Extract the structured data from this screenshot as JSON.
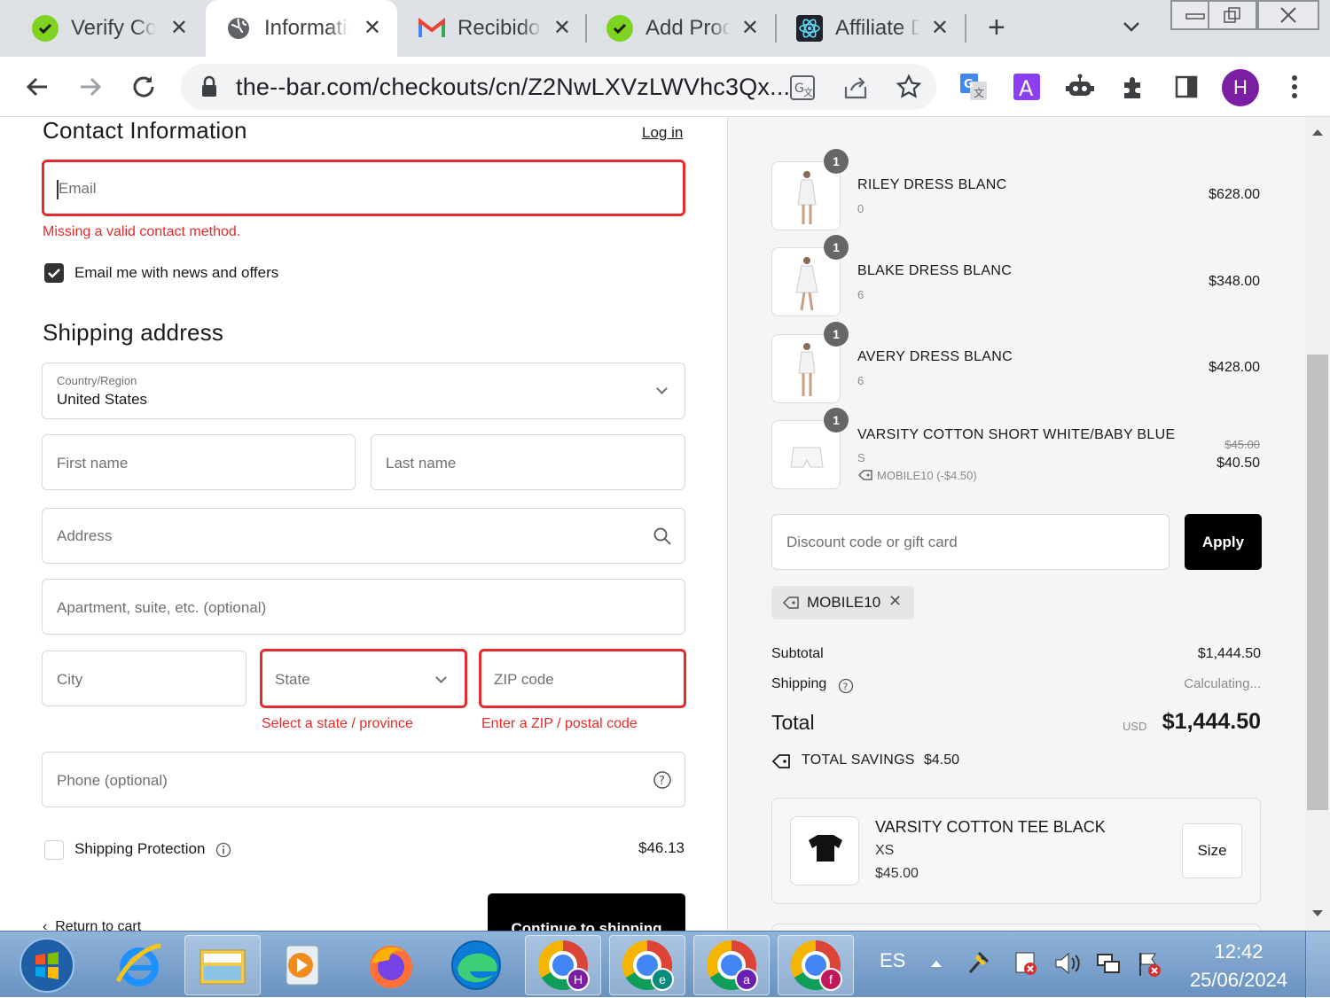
{
  "browser": {
    "tabs": [
      {
        "title": "Verify Code",
        "icon": "shopify-check-icon",
        "active": false
      },
      {
        "title": "Information",
        "icon": "globe-icon",
        "active": true
      },
      {
        "title": "Recibidos",
        "icon": "gmail-icon",
        "active": false
      },
      {
        "title": "Add Product",
        "icon": "shopify-check-icon",
        "active": false
      },
      {
        "title": "Affiliate Dashboard",
        "icon": "react-icon",
        "active": false
      }
    ],
    "url": "the--bar.com/checkouts/cn/Z2NwLXVzLWVhc3Qx...",
    "profile_initial": "H"
  },
  "contact": {
    "heading": "Contact Information",
    "login_link": "Log in",
    "email_placeholder": "Email",
    "email_error": "Missing a valid contact method.",
    "newsletter_label": "Email me with news and offers"
  },
  "shipping": {
    "heading": "Shipping address",
    "country_label": "Country/Region",
    "country_value": "United States",
    "first_name_placeholder": "First name",
    "last_name_placeholder": "Last name",
    "address_placeholder": "Address",
    "apartment_placeholder": "Apartment, suite, etc. (optional)",
    "city_placeholder": "City",
    "state_placeholder": "State",
    "state_error": "Select a state / province",
    "zip_placeholder": "ZIP code",
    "zip_error": "Enter a ZIP / postal code",
    "phone_placeholder": "Phone (optional)",
    "protection_label": "Shipping Protection",
    "protection_price": "$46.13",
    "return_link": "Return to cart",
    "continue_button": "Continue to shipping"
  },
  "summary": {
    "items": [
      {
        "qty": "1",
        "name": "RILEY DRESS BLANC",
        "variant": "0",
        "price": "$628.00"
      },
      {
        "qty": "1",
        "name": "BLAKE DRESS BLANC",
        "variant": "6",
        "price": "$348.00"
      },
      {
        "qty": "1",
        "name": "AVERY DRESS BLANC",
        "variant": "6",
        "price": "$428.00"
      },
      {
        "qty": "1",
        "name": "VARSITY COTTON SHORT WHITE/BABY BLUE",
        "variant": "S",
        "discount": "MOBILE10 (-$4.50)",
        "old_price": "$45.00",
        "price": "$40.50"
      }
    ],
    "discount_placeholder": "Discount code or gift card",
    "apply_label": "Apply",
    "applied_code": "MOBILE10",
    "subtotal_label": "Subtotal",
    "subtotal_value": "$1,444.50",
    "shipping_label": "Shipping",
    "shipping_value": "Calculating...",
    "total_label": "Total",
    "currency": "USD",
    "total_value": "$1,444.50",
    "savings_label": "TOTAL SAVINGS",
    "savings_value": "$4.50",
    "upsell": {
      "name": "VARSITY COTTON TEE BLACK",
      "variant": "XS",
      "price": "$45.00",
      "size_button": "Size"
    }
  },
  "taskbar": {
    "language": "ES",
    "time": "12:42",
    "date": "25/06/2024",
    "chrome_profiles": [
      "H",
      "e",
      "a",
      "f"
    ]
  },
  "colors": {
    "error": "#e32c2b",
    "apply_bg": "#000000",
    "profile": "#7b1fa2"
  }
}
